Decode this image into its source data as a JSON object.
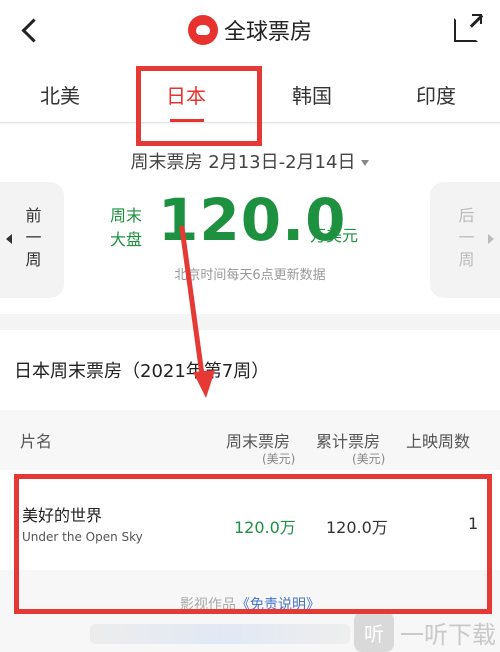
{
  "header": {
    "title": "全球票房",
    "back_icon": "chevron-left-icon",
    "share_icon": "share-icon"
  },
  "tabs": [
    {
      "label": "北美",
      "active": false
    },
    {
      "label": "日本",
      "active": true
    },
    {
      "label": "韩国",
      "active": false
    },
    {
      "label": "印度",
      "active": false
    }
  ],
  "summary": {
    "week_selector": "周末票房 2月13日-2月14日",
    "prev_label": "前一周",
    "next_label": "后一周",
    "total_label_line1": "周末",
    "total_label_line2": "大盘",
    "total_value": "120.0",
    "total_unit": "万美元",
    "update_note": "北京时间每天6点更新数据"
  },
  "section": {
    "title": "日本周末票房（2021年第7周）"
  },
  "table": {
    "headers": {
      "name": "片名",
      "weekend": "周末票房",
      "weekend_unit": "(美元)",
      "cumulative": "累计票房",
      "cumulative_unit": "(美元)",
      "weeks": "上映周数"
    },
    "rows": [
      {
        "name": "美好的世界",
        "english": "Under the Open Sky",
        "weekend": "120.0万",
        "cumulative": "120.0万",
        "weeks": "1"
      }
    ]
  },
  "footer": {
    "disclaimer_prefix": "影视作品",
    "disclaimer_link": "《免责说明》"
  },
  "watermark": {
    "icon_text": "听",
    "text": "一听下载"
  },
  "colors": {
    "accent_red": "#e8322f",
    "box_office_green": "#1e9140",
    "annotation_red": "#e53935"
  }
}
